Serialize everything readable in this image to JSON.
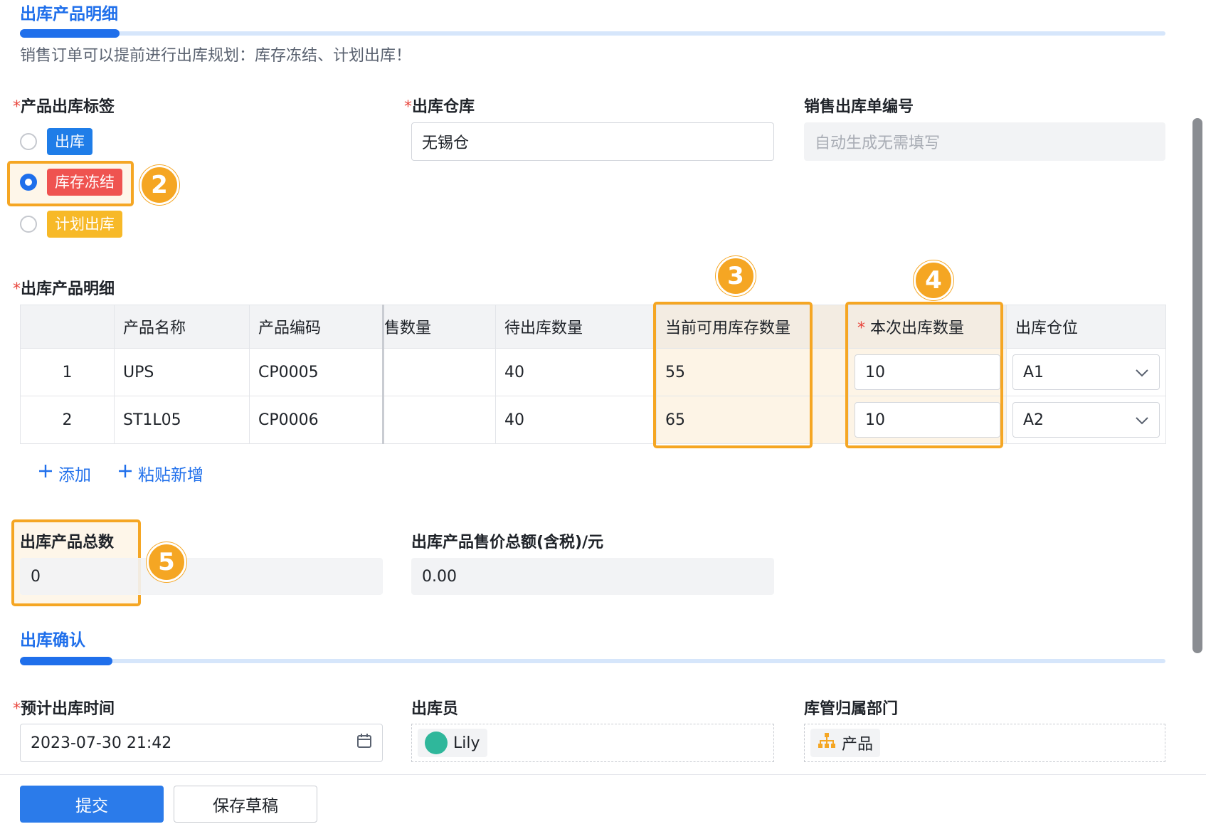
{
  "detail_section": {
    "title": "出库产品明细",
    "hint": "销售订单可以提前进行出库规划：库存冻结、计划出库！"
  },
  "form": {
    "tag_field": {
      "label": "产品出库标签",
      "required_mark": "*",
      "options": [
        {
          "label": "出库",
          "color": "#1f7de8",
          "selected": false
        },
        {
          "label": "库存冻结",
          "color": "#ef5350",
          "selected": true
        },
        {
          "label": "计划出库",
          "color": "#f7b928",
          "selected": false
        }
      ]
    },
    "warehouse": {
      "label": "出库仓库",
      "required_mark": "*",
      "value": "无锡仓"
    },
    "order_no": {
      "label": "销售出库单编号",
      "placeholder": "自动生成无需填写"
    }
  },
  "product_table": {
    "label": "出库产品明细",
    "required_mark": "*",
    "columns": [
      "",
      "产品名称",
      "产品编码",
      "售数量",
      "待出库数量",
      "当前可用库存数量",
      "本次出库数量",
      "出库仓位"
    ],
    "required_column_mark": "*",
    "rows": [
      {
        "index": "1",
        "name": "UPS",
        "code": "CP0005",
        "sale_qty": "",
        "pending_qty": "40",
        "available_qty": "55",
        "out_qty": "10",
        "location": "A1"
      },
      {
        "index": "2",
        "name": "ST1L05",
        "code": "CP0006",
        "sale_qty": "",
        "pending_qty": "40",
        "available_qty": "65",
        "out_qty": "10",
        "location": "A2"
      }
    ],
    "add_label": "添加",
    "paste_label": "粘贴新增"
  },
  "totals": {
    "count_label": "出库产品总数",
    "count_value": "0",
    "amount_label": "出库产品售价总额(含税)/元",
    "amount_value": "0.00"
  },
  "confirm_section": {
    "title": "出库确认",
    "date": {
      "label": "预计出库时间",
      "required_mark": "*",
      "value": "2023-07-30 21:42"
    },
    "operator": {
      "label": "出库员",
      "value": "Lily"
    },
    "department": {
      "label": "库管归属部门",
      "value": "产品"
    }
  },
  "footer": {
    "submit_label": "提交",
    "draft_label": "保存草稿"
  },
  "markers": [
    "2",
    "3",
    "4",
    "5"
  ],
  "highlight_color": "#f5a623"
}
